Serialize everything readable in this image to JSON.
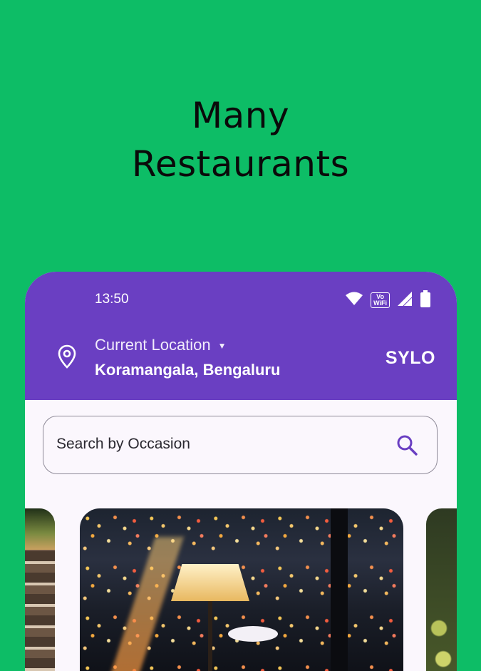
{
  "promo": {
    "title_line1": "Many",
    "title_line2": "Restaurants"
  },
  "status_bar": {
    "time": "13:50",
    "volte_line1": "Vo",
    "volte_line2": "WiFi"
  },
  "header": {
    "location_label": "Current Location",
    "location_value": "Koramangala, Bengaluru",
    "brand": "SYLO"
  },
  "search": {
    "placeholder": "Search by Occasion"
  },
  "colors": {
    "background": "#0dbd66",
    "app_bar": "#6a3fc2",
    "search_icon": "#6a3fc2"
  },
  "icons": [
    "wifi-icon",
    "volte-icon",
    "signal-icon",
    "battery-icon",
    "location-pin-icon",
    "caret-down-icon",
    "search-icon"
  ]
}
